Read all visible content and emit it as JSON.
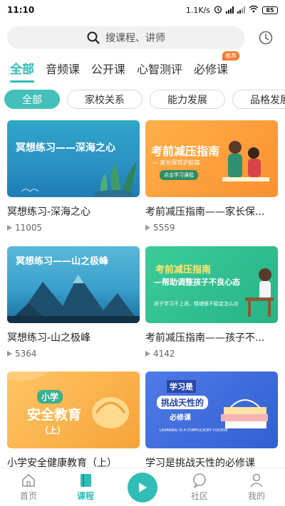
{
  "status": {
    "time": "11:10",
    "speed": "1.1K/s",
    "battery": "85"
  },
  "search": {
    "placeholder": "搜课程、讲师"
  },
  "tabs": [
    {
      "label": "全部",
      "active": true
    },
    {
      "label": "音频课"
    },
    {
      "label": "公开课"
    },
    {
      "label": "心智测评"
    },
    {
      "label": "必修课",
      "badge": "推荐"
    }
  ],
  "chips": [
    {
      "label": "全部",
      "active": true
    },
    {
      "label": "家校关系"
    },
    {
      "label": "能力发展"
    },
    {
      "label": "品格发展"
    }
  ],
  "courses": [
    {
      "title": "冥想练习-深海之心",
      "views": "11005",
      "thumb_text": "冥想练习——深海之心"
    },
    {
      "title": "考前减压指南——家长保...",
      "views": "5559",
      "thumb_text": "考前减压指南",
      "thumb_sub": "— 家长保驾护航篇",
      "thumb_btn": "点击学习课程"
    },
    {
      "title": "冥想练习-山之极峰",
      "views": "5364",
      "thumb_text": "冥想练习——山之极峰"
    },
    {
      "title": "考前减压指南——孩子不...",
      "views": "4142",
      "thumb_text": "考前减压指南",
      "thumb_sub": "—帮助调整孩子不良心态",
      "thumb_note": "孩子学习不上进，情绪很不稳定怎么办"
    },
    {
      "title": "小学安全健康教育（上）",
      "views": "",
      "thumb_text": "安全教育",
      "thumb_tag": "小学",
      "thumb_sub": "（上）"
    },
    {
      "title": "学习是挑战天性的必修课",
      "views": "",
      "thumb_text": "学习是",
      "thumb_text2": "挑战天性的",
      "thumb_text3": "必修课",
      "thumb_en": "LEARNING IS A COMPULSORY COURSE"
    }
  ],
  "bottom_nav": [
    {
      "label": "首页"
    },
    {
      "label": "课程",
      "active": true
    },
    {
      "label": ""
    },
    {
      "label": "社区"
    },
    {
      "label": "我的"
    }
  ],
  "colors": {
    "accent": "#2fbdb5",
    "badge": "#f07a2d"
  }
}
